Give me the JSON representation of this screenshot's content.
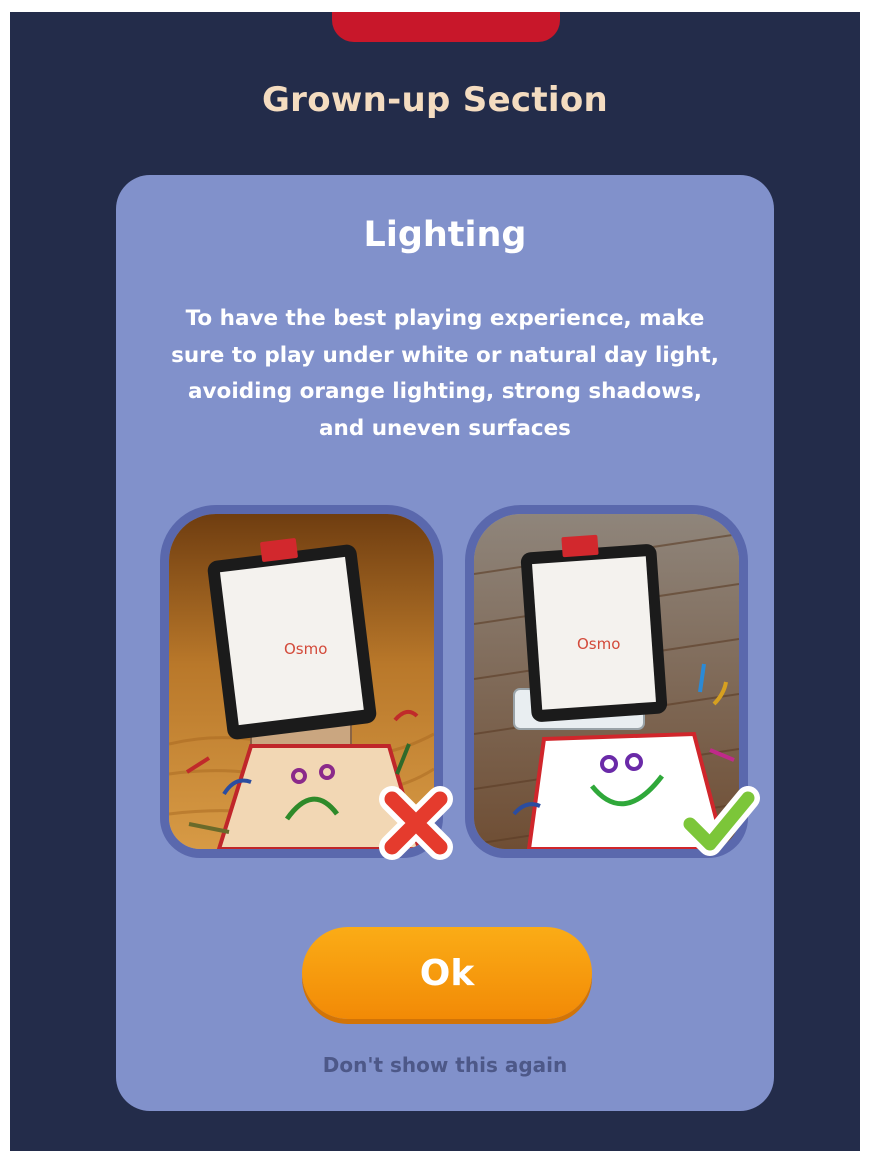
{
  "header": {
    "title": "Grown-up Section"
  },
  "dialog": {
    "title": "Lighting",
    "body": "To have the best playing experience, make sure to play under white or natural day light, avoiding orange lighting, strong shadows, and uneven surfaces",
    "images": [
      {
        "label": "Osmo",
        "logo_text": "Osmo",
        "verdict": "incorrect",
        "icon": "x-mark-icon"
      },
      {
        "label": "Osmo",
        "logo_text": "Osmo",
        "verdict": "correct",
        "icon": "checkmark-icon"
      }
    ],
    "ok_label": "Ok",
    "dont_show_label": "Don't show this again"
  },
  "colors": {
    "background": "#232c4a",
    "card": "#8191cb",
    "title_text": "#f4dcc0",
    "ok_button": "#f7990e",
    "top_tab": "#c8172a",
    "x_mark": "#e53b2d",
    "check_mark": "#7cc639"
  }
}
